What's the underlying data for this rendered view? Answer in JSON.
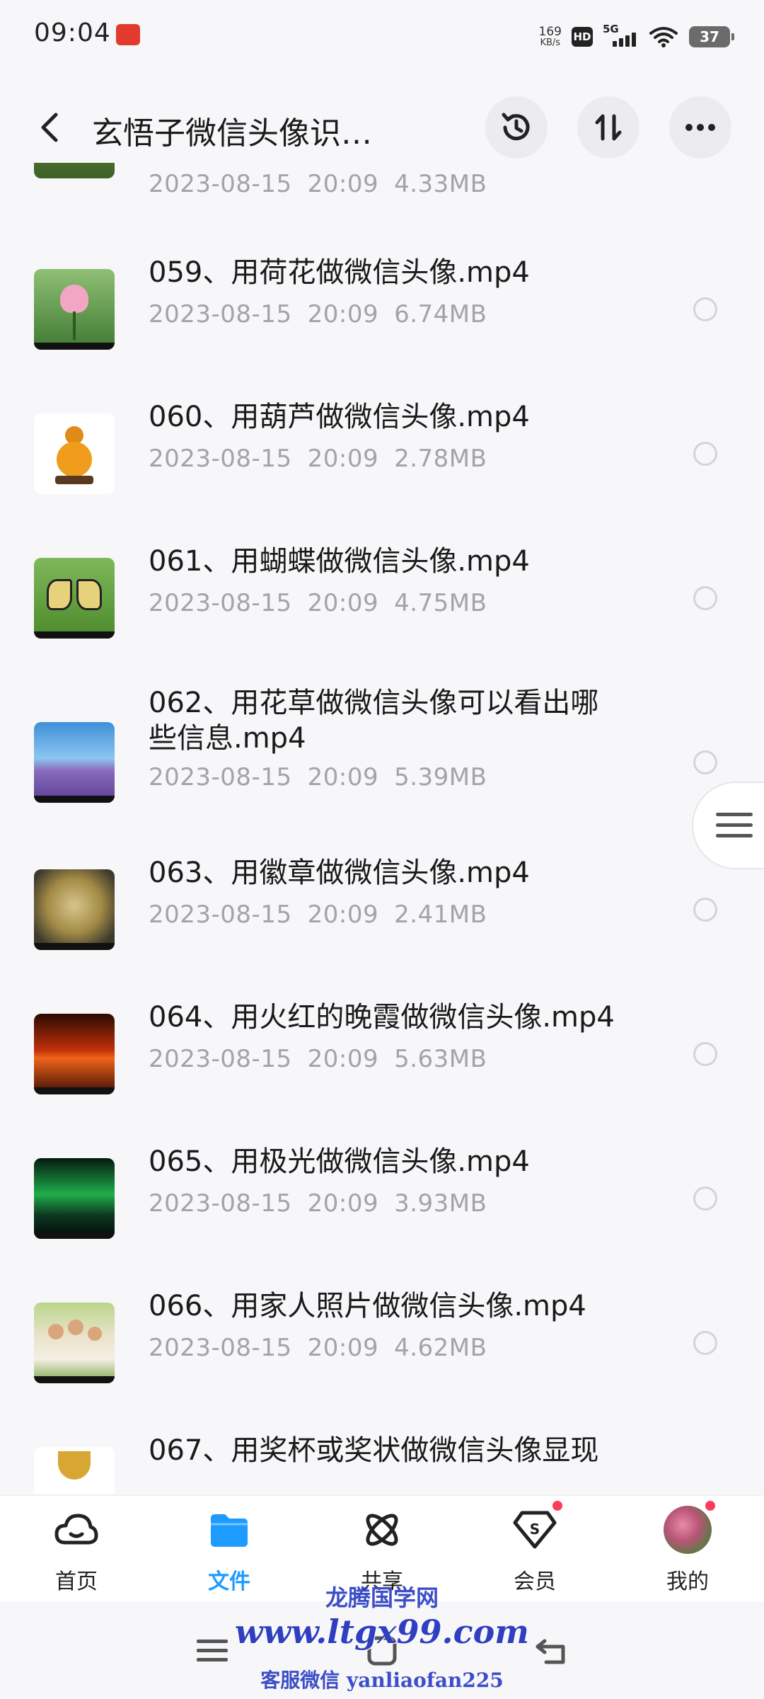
{
  "status_bar": {
    "time": "09:04",
    "net_speed_value": "169",
    "net_speed_unit": "KB/s",
    "hd": "HD",
    "network": "5G",
    "battery": "37"
  },
  "header": {
    "title": "玄悟子微信头像识…",
    "icons": [
      "back-icon",
      "history-icon",
      "sort-icon",
      "more-icon"
    ]
  },
  "files": [
    {
      "name": "",
      "date": "2023-08-15",
      "time": "20:09",
      "size": "4.33MB"
    },
    {
      "name": "059、用荷花做微信头像.mp4",
      "date": "2023-08-15",
      "time": "20:09",
      "size": "6.74MB"
    },
    {
      "name": "060、用葫芦做微信头像.mp4",
      "date": "2023-08-15",
      "time": "20:09",
      "size": "2.78MB"
    },
    {
      "name": "061、用蝴蝶做微信头像.mp4",
      "date": "2023-08-15",
      "time": "20:09",
      "size": "4.75MB"
    },
    {
      "name": "062、用花草做微信头像可以看出哪些信息.mp4",
      "name_line1": "062、用花草做微信头像可以看出哪",
      "name_line2": "些信息.mp4",
      "date": "2023-08-15",
      "time": "20:09",
      "size": "5.39MB"
    },
    {
      "name": "063、用徽章做微信头像.mp4",
      "date": "2023-08-15",
      "time": "20:09",
      "size": "2.41MB"
    },
    {
      "name": "064、用火红的晚霞做微信头像.mp4",
      "date": "2023-08-15",
      "time": "20:09",
      "size": "5.63MB"
    },
    {
      "name": "065、用极光做微信头像.mp4",
      "date": "2023-08-15",
      "time": "20:09",
      "size": "3.93MB"
    },
    {
      "name": "066、用家人照片做微信头像.mp4",
      "date": "2023-08-15",
      "time": "20:09",
      "size": "4.62MB"
    },
    {
      "name": "067、用奖杯或奖状做微信头像显现",
      "date": "",
      "time": "",
      "size": ""
    }
  ],
  "bottom_nav": [
    {
      "label": "首页",
      "icon": "cloud-home-icon"
    },
    {
      "label": "文件",
      "icon": "folder-icon",
      "active": true
    },
    {
      "label": "共享",
      "icon": "share-atom-icon"
    },
    {
      "label": "会员",
      "icon": "vip-diamond-icon",
      "badge": true
    },
    {
      "label": "我的",
      "icon": "avatar",
      "badge": true
    }
  ],
  "watermark": {
    "line1": "龙腾国学网",
    "line2": "www.ltgx99.com",
    "line3": "客服微信 yanliaofan225"
  },
  "colors": {
    "accent": "#1e9bff",
    "badge": "#ff3b5c",
    "meta_text": "#a3a3a8",
    "background": "#f7f7f9"
  }
}
